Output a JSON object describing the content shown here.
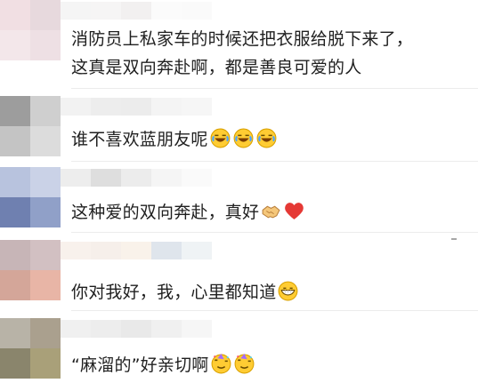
{
  "comments": [
    {
      "text_lines": [
        "消防员上私家车的时候还把衣服给脱下来了，",
        "这真是双向奔赴啊，都是善良可爱的人"
      ],
      "emoji": [],
      "avatar_colors": [
        "#f1dfe3",
        "#e7d9dd",
        "#f3e7ea",
        "#eee0e4"
      ],
      "name_colors": [
        "#f4f4f4",
        "#f6f4f4",
        "#f1efef",
        "#fbfbfb",
        "#fafafa"
      ]
    },
    {
      "text_lines": [
        "谁不喜欢蓝朋友呢"
      ],
      "emoji": [
        "laughing-crying-emoji",
        "laughing-crying-emoji",
        "laughing-crying-emoji"
      ],
      "avatar_colors": [
        "#9d9d9d",
        "#cfcfcf",
        "#c4c4c4",
        "#dcdcdc"
      ],
      "name_colors": [
        "#f1f1f1",
        "#ececec",
        "#ebebeb",
        "#f3f3f3",
        "#f6f6f6"
      ]
    },
    {
      "text_lines": [
        "这种爱的双向奔赴，真好"
      ],
      "emoji": [
        "handshake-emoji",
        "red-heart-emoji"
      ],
      "avatar_colors": [
        "#b8c3de",
        "#cad2e7",
        "#6f80b0",
        "#90a0c8"
      ],
      "name_colors": [
        "#ececec",
        "#dbdbdb",
        "#eaeaea",
        "#f4f4f4",
        "#fafafa"
      ]
    },
    {
      "text_lines": [
        "你对我好，我，心里都知道"
      ],
      "emoji": [
        "grinning-emoji"
      ],
      "avatar_colors": [
        "#c7b5b7",
        "#d2c0c2",
        "#d4a699",
        "#e8b5a6"
      ],
      "name_colors": [
        "#f8f0ea",
        "#f6eee8",
        "#f9f1e8",
        "#dce3ea",
        "#eef2f4"
      ]
    },
    {
      "text_lines": [
        "“麻溜的”好亲切啊"
      ],
      "emoji": [
        "party-face-emoji",
        "party-face-emoji"
      ],
      "avatar_colors": [
        "#b8b3a7",
        "#aaa08e",
        "#8a856c",
        "#a9a079"
      ],
      "name_colors": [
        "#efefef",
        "#ececec",
        "#e7e7e7",
        "#efefef",
        "#f6f6f6"
      ]
    }
  ]
}
